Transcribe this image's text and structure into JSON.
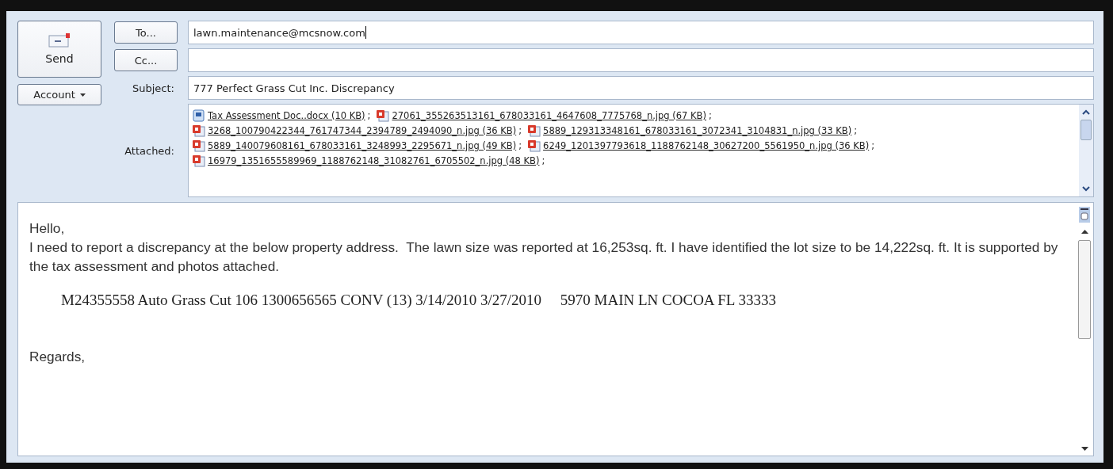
{
  "header": {
    "send_label": "Send",
    "to_label": "To...",
    "cc_label": "Cc...",
    "account_label": "Account",
    "subject_label": "Subject:",
    "attached_label": "Attached:"
  },
  "to": {
    "value": "lawn.maintenance@mcsnow.com"
  },
  "subject": {
    "value": "777 Perfect Grass Cut Inc. Discrepancy"
  },
  "attachments": [
    [
      {
        "kind": "doc",
        "name": "Tax Assessment Doc..docx (10 KB)",
        "separator": ";"
      },
      {
        "kind": "image",
        "name": "27061_355263513161_678033161_4647608_7775768_n.jpg (67 KB)",
        "separator": ";"
      }
    ],
    [
      {
        "kind": "image",
        "name": "3268_100790422344_761747344_2394789_2494090_n.jpg (36 KB)",
        "separator": ";"
      },
      {
        "kind": "image",
        "name": "5889_129313348161_678033161_3072341_3104831_n.jpg (33 KB)",
        "separator": ";"
      }
    ],
    [
      {
        "kind": "image",
        "name": "5889_140079608161_678033161_3248993_2295671_n.jpg (49 KB)",
        "separator": ";"
      },
      {
        "kind": "image",
        "name": "6249_1201397793618_1188762148_30627200_5561950_n.jpg (36 KB)",
        "separator": ";"
      }
    ],
    [
      {
        "kind": "image",
        "name": "16979_1351655589969_1188762148_31082761_6705502_n.jpg (48 KB)",
        "separator": ";"
      }
    ]
  ],
  "body": {
    "greeting": "Hello,",
    "paragraph": "I need to report a discrepancy at the below property address.  The lawn size was reported at 16,253sq. ft. I have identified the lot size to be 14,222sq. ft. It is supported by the tax assessment and photos attached.",
    "record": "M24355558 Auto Grass Cut 106 1300656565 CONV (13) 3/14/2010 3/27/2010     5970 MAIN LN COCOA FL 33333",
    "closing": "Regards,"
  }
}
